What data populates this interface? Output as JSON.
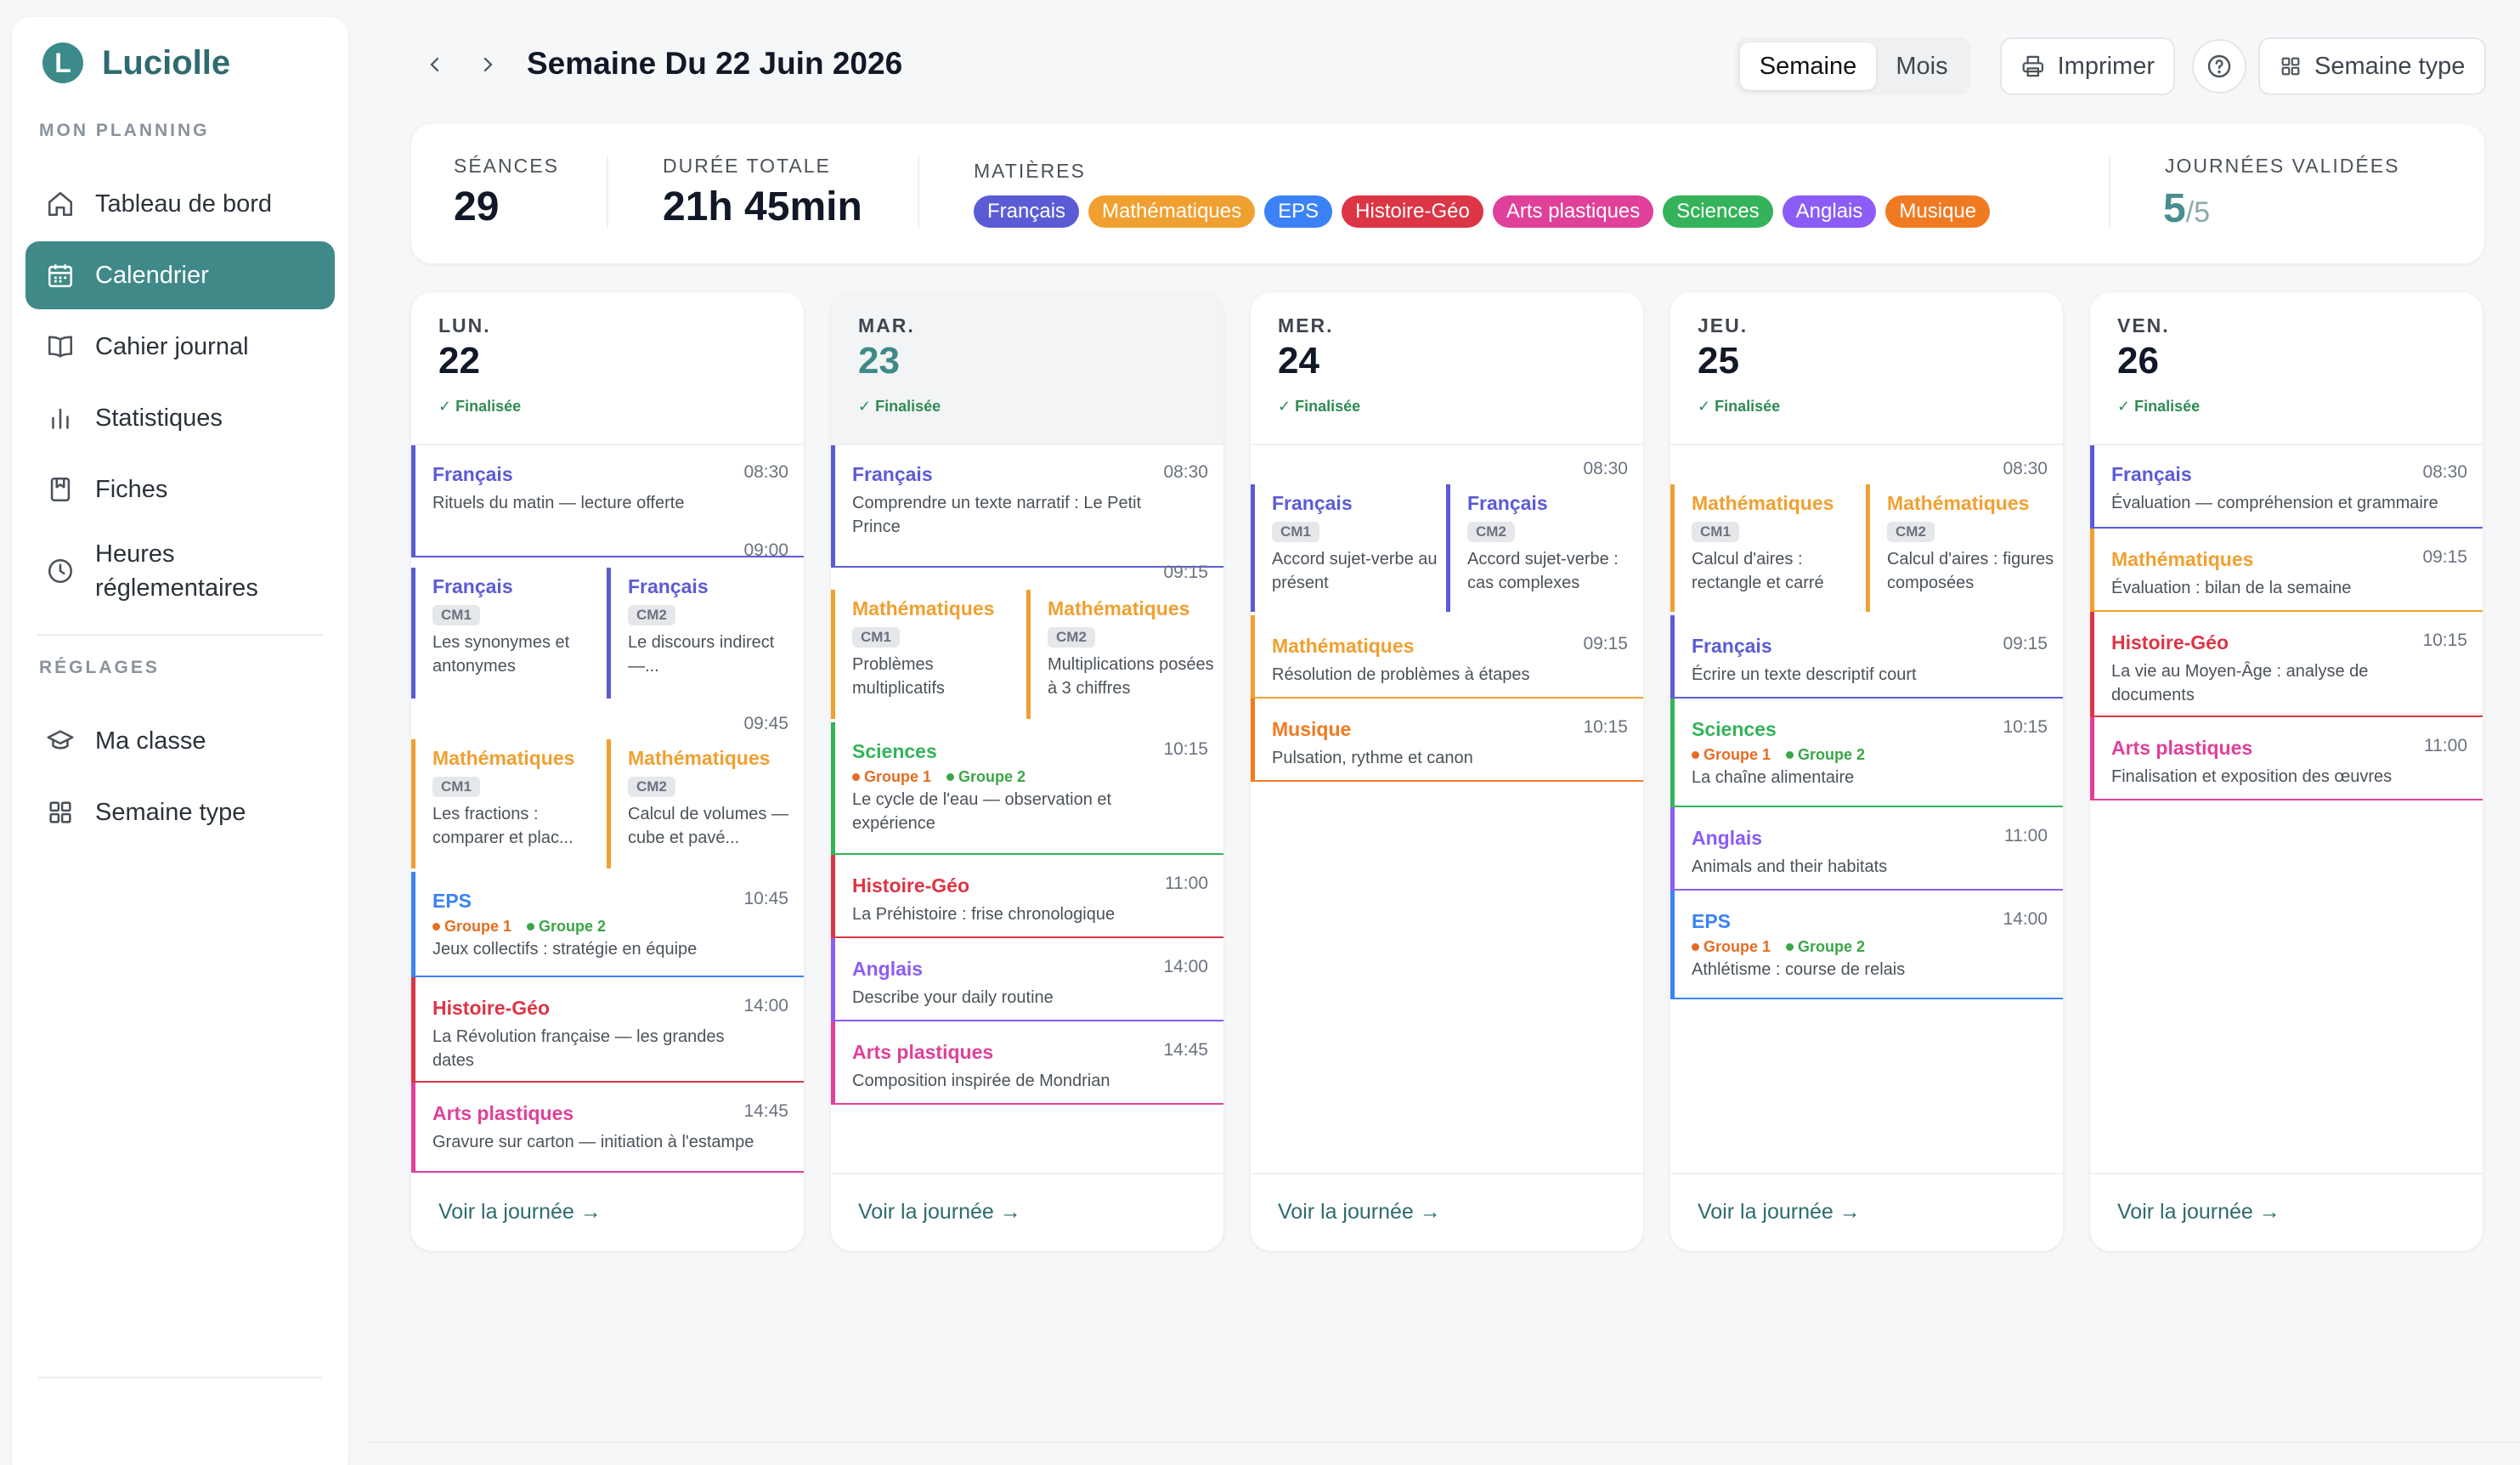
{
  "app": {
    "name": "Luciolle",
    "logo_letter": "L"
  },
  "sidebar": {
    "section1": "MON PLANNING",
    "section2": "RÉGLAGES",
    "items": [
      {
        "label": "Tableau de bord",
        "icon": "home-icon",
        "active": false
      },
      {
        "label": "Calendrier",
        "icon": "calendar-icon",
        "active": true
      },
      {
        "label": "Cahier journal",
        "icon": "book-icon",
        "active": false
      },
      {
        "label": "Statistiques",
        "icon": "bar-chart-icon",
        "active": false
      },
      {
        "label": "Fiches",
        "icon": "bookmark-icon",
        "active": false
      },
      {
        "label": "Heures réglementaires",
        "icon": "clock-icon",
        "active": false
      }
    ],
    "settings_items": [
      {
        "label": "Ma classe",
        "icon": "graduation-cap-icon"
      },
      {
        "label": "Semaine type",
        "icon": "grid-icon"
      }
    ]
  },
  "header": {
    "title": "Semaine Du 22 Juin 2026",
    "view_week": "Semaine",
    "view_month": "Mois",
    "print": "Imprimer",
    "template_week": "Semaine type"
  },
  "stats": {
    "sessions_label": "SÉANCES",
    "sessions_value": "29",
    "duration_label": "DURÉE TOTALE",
    "duration_value": "21h 45min",
    "subjects_label": "MATIÈRES",
    "validated_label": "JOURNÉES VALIDÉES",
    "validated_value": "5",
    "validated_total": "/5"
  },
  "subjects": [
    {
      "name": "Français",
      "color": "#5b5bd6"
    },
    {
      "name": "Mathématiques",
      "color": "#f0a030"
    },
    {
      "name": "EPS",
      "color": "#3b82f6"
    },
    {
      "name": "Histoire-Géo",
      "color": "#dc3545"
    },
    {
      "name": "Arts plastiques",
      "color": "#e0409a"
    },
    {
      "name": "Sciences",
      "color": "#34b35a"
    },
    {
      "name": "Anglais",
      "color": "#8b5cf6"
    },
    {
      "name": "Musique",
      "color": "#f07a22"
    }
  ],
  "colors": {
    "accent": "#3f8a89",
    "finalized": "#2f8a53",
    "group1": "#e36d23",
    "group2": "#3aa647"
  },
  "days": [
    {
      "name": "LUN.",
      "num": "22",
      "status": "✓ Finalisée",
      "footer": "Voir la journée →",
      "sessions": {
        "s1": {
          "title": "Français",
          "time": "08:30",
          "desc": "Rituels du matin — lecture offerte"
        },
        "t2": "09:00",
        "s2a": {
          "title": "Français",
          "level": "CM1",
          "desc": "Les synonymes et antonymes"
        },
        "s2b": {
          "title": "Français",
          "level": "CM2",
          "desc": "Le discours indirect —..."
        },
        "t3": "09:45",
        "s3a": {
          "title": "Mathématiques",
          "level": "CM1",
          "desc": "Les fractions : comparer et plac..."
        },
        "s3b": {
          "title": "Mathématiques",
          "level": "CM2",
          "desc": "Calcul de volumes — cube et pavé..."
        },
        "s4": {
          "title": "EPS",
          "time": "10:45",
          "g1": "Groupe 1",
          "g2": "Groupe 2",
          "desc": "Jeux collectifs : stratégie en équipe"
        },
        "s5": {
          "title": "Histoire-Géo",
          "time": "14:00",
          "desc": "La Révolution française — les grandes dates"
        },
        "s6": {
          "title": "Arts plastiques",
          "time": "14:45",
          "desc": "Gravure sur carton — initiation à l'estampe"
        }
      }
    },
    {
      "name": "MAR.",
      "num": "23",
      "status": "✓ Finalisée",
      "footer": "Voir la journée →",
      "sessions": {
        "s1": {
          "title": "Français",
          "time": "08:30",
          "desc": "Comprendre un texte narratif : Le Petit Prince"
        },
        "t2": "09:15",
        "s2a": {
          "title": "Mathématiques",
          "level": "CM1",
          "desc": "Problèmes multiplicatifs"
        },
        "s2b": {
          "title": "Mathématiques",
          "level": "CM2",
          "desc": "Multiplications posées à 3 chiffres"
        },
        "s3": {
          "title": "Sciences",
          "time": "10:15",
          "g1": "Groupe 1",
          "g2": "Groupe 2",
          "desc": "Le cycle de l'eau — observation et expérience"
        },
        "s4": {
          "title": "Histoire-Géo",
          "time": "11:00",
          "desc": "La Préhistoire : frise chronologique"
        },
        "s5": {
          "title": "Anglais",
          "time": "14:00",
          "desc": "Describe your daily routine"
        },
        "s6": {
          "title": "Arts plastiques",
          "time": "14:45",
          "desc": "Composition inspirée de Mondrian"
        }
      }
    },
    {
      "name": "MER.",
      "num": "24",
      "status": "✓ Finalisée",
      "footer": "Voir la journée →",
      "sessions": {
        "t1": "08:30",
        "s1a": {
          "title": "Français",
          "level": "CM1",
          "desc": "Accord sujet-verbe au présent"
        },
        "s1b": {
          "title": "Français",
          "level": "CM2",
          "desc": "Accord sujet-verbe : cas complexes"
        },
        "s2": {
          "title": "Mathématiques",
          "time": "09:15",
          "desc": "Résolution de problèmes à étapes"
        },
        "s3": {
          "title": "Musique",
          "time": "10:15",
          "desc": "Pulsation, rythme et canon"
        }
      }
    },
    {
      "name": "JEU.",
      "num": "25",
      "status": "✓ Finalisée",
      "footer": "Voir la journée →",
      "sessions": {
        "t1": "08:30",
        "s1a": {
          "title": "Mathématiques",
          "level": "CM1",
          "desc": "Calcul d'aires : rectangle et carré"
        },
        "s1b": {
          "title": "Mathématiques",
          "level": "CM2",
          "desc": "Calcul d'aires : figures composées"
        },
        "s2": {
          "title": "Français",
          "time": "09:15",
          "desc": "Écrire un texte descriptif court"
        },
        "s3": {
          "title": "Sciences",
          "time": "10:15",
          "g1": "Groupe 1",
          "g2": "Groupe 2",
          "desc": "La chaîne alimentaire"
        },
        "s4": {
          "title": "Anglais",
          "time": "11:00",
          "desc": "Animals and their habitats"
        },
        "s5": {
          "title": "EPS",
          "time": "14:00",
          "g1": "Groupe 1",
          "g2": "Groupe 2",
          "desc": "Athlétisme : course de relais"
        }
      }
    },
    {
      "name": "VEN.",
      "num": "26",
      "status": "✓ Finalisée",
      "footer": "Voir la journée →",
      "sessions": {
        "s1": {
          "title": "Français",
          "time": "08:30",
          "desc": "Évaluation — compréhension et grammaire"
        },
        "s2": {
          "title": "Mathématiques",
          "time": "09:15",
          "desc": "Évaluation : bilan de la semaine"
        },
        "s3": {
          "title": "Histoire-Géo",
          "time": "10:15",
          "desc": "La vie au Moyen-Âge : analyse de documents"
        },
        "s4": {
          "title": "Arts plastiques",
          "time": "11:00",
          "desc": "Finalisation et exposition des œuvres"
        }
      }
    }
  ]
}
